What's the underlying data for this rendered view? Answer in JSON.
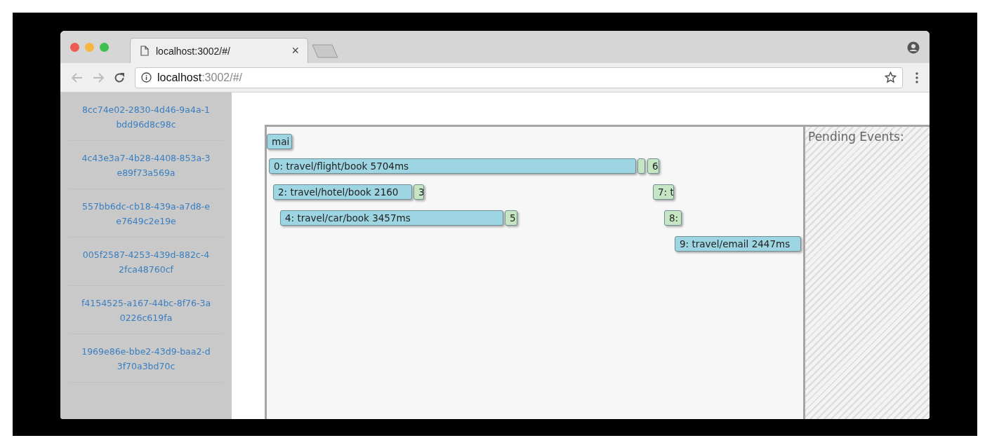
{
  "browser": {
    "tab_title": "localhost:3002/#/",
    "tab_close": "×",
    "url_host": "localhost",
    "url_rest": ":3002/#/"
  },
  "sidebar": {
    "items": [
      {
        "label": "8cc74e02-2830-4d46-9a4a-1bdd96d8c98c"
      },
      {
        "label": "4c43e3a7-4b28-4408-853a-3e89f73a569a"
      },
      {
        "label": "557bb6dc-cb18-439a-a7d8-ee7649c2e19e"
      },
      {
        "label": "005f2587-4253-439d-882c-42fca48760cf"
      },
      {
        "label": "f4154525-a167-44bc-8f76-3a0226c619fa"
      },
      {
        "label": "1969e86e-bbe2-43d9-baa2-d3f70a3bd70c"
      }
    ]
  },
  "timeline": {
    "spans": [
      {
        "label": "mai",
        "color": "#9dd5e2"
      },
      {
        "label": "0: travel/flight/book 5704ms",
        "color": "#9dd5e2"
      },
      {
        "color": "#c6e6c3"
      },
      {
        "label": "6",
        "color": "#c6e6c3"
      },
      {
        "label": "2: travel/hotel/book 2160",
        "color": "#9dd5e2"
      },
      {
        "label": "3",
        "color": "#c6e6c3"
      },
      {
        "label": "7: t",
        "color": "#c6e6c3"
      },
      {
        "label": "4: travel/car/book 3457ms",
        "color": "#9dd5e2"
      },
      {
        "label": "5",
        "color": "#c6e6c3"
      },
      {
        "label": "8:",
        "color": "#c6e6c3"
      },
      {
        "label": "9: travel/email 2447ms",
        "color": "#9dd5e2"
      }
    ]
  },
  "pending": {
    "title": "Pending Events:"
  }
}
